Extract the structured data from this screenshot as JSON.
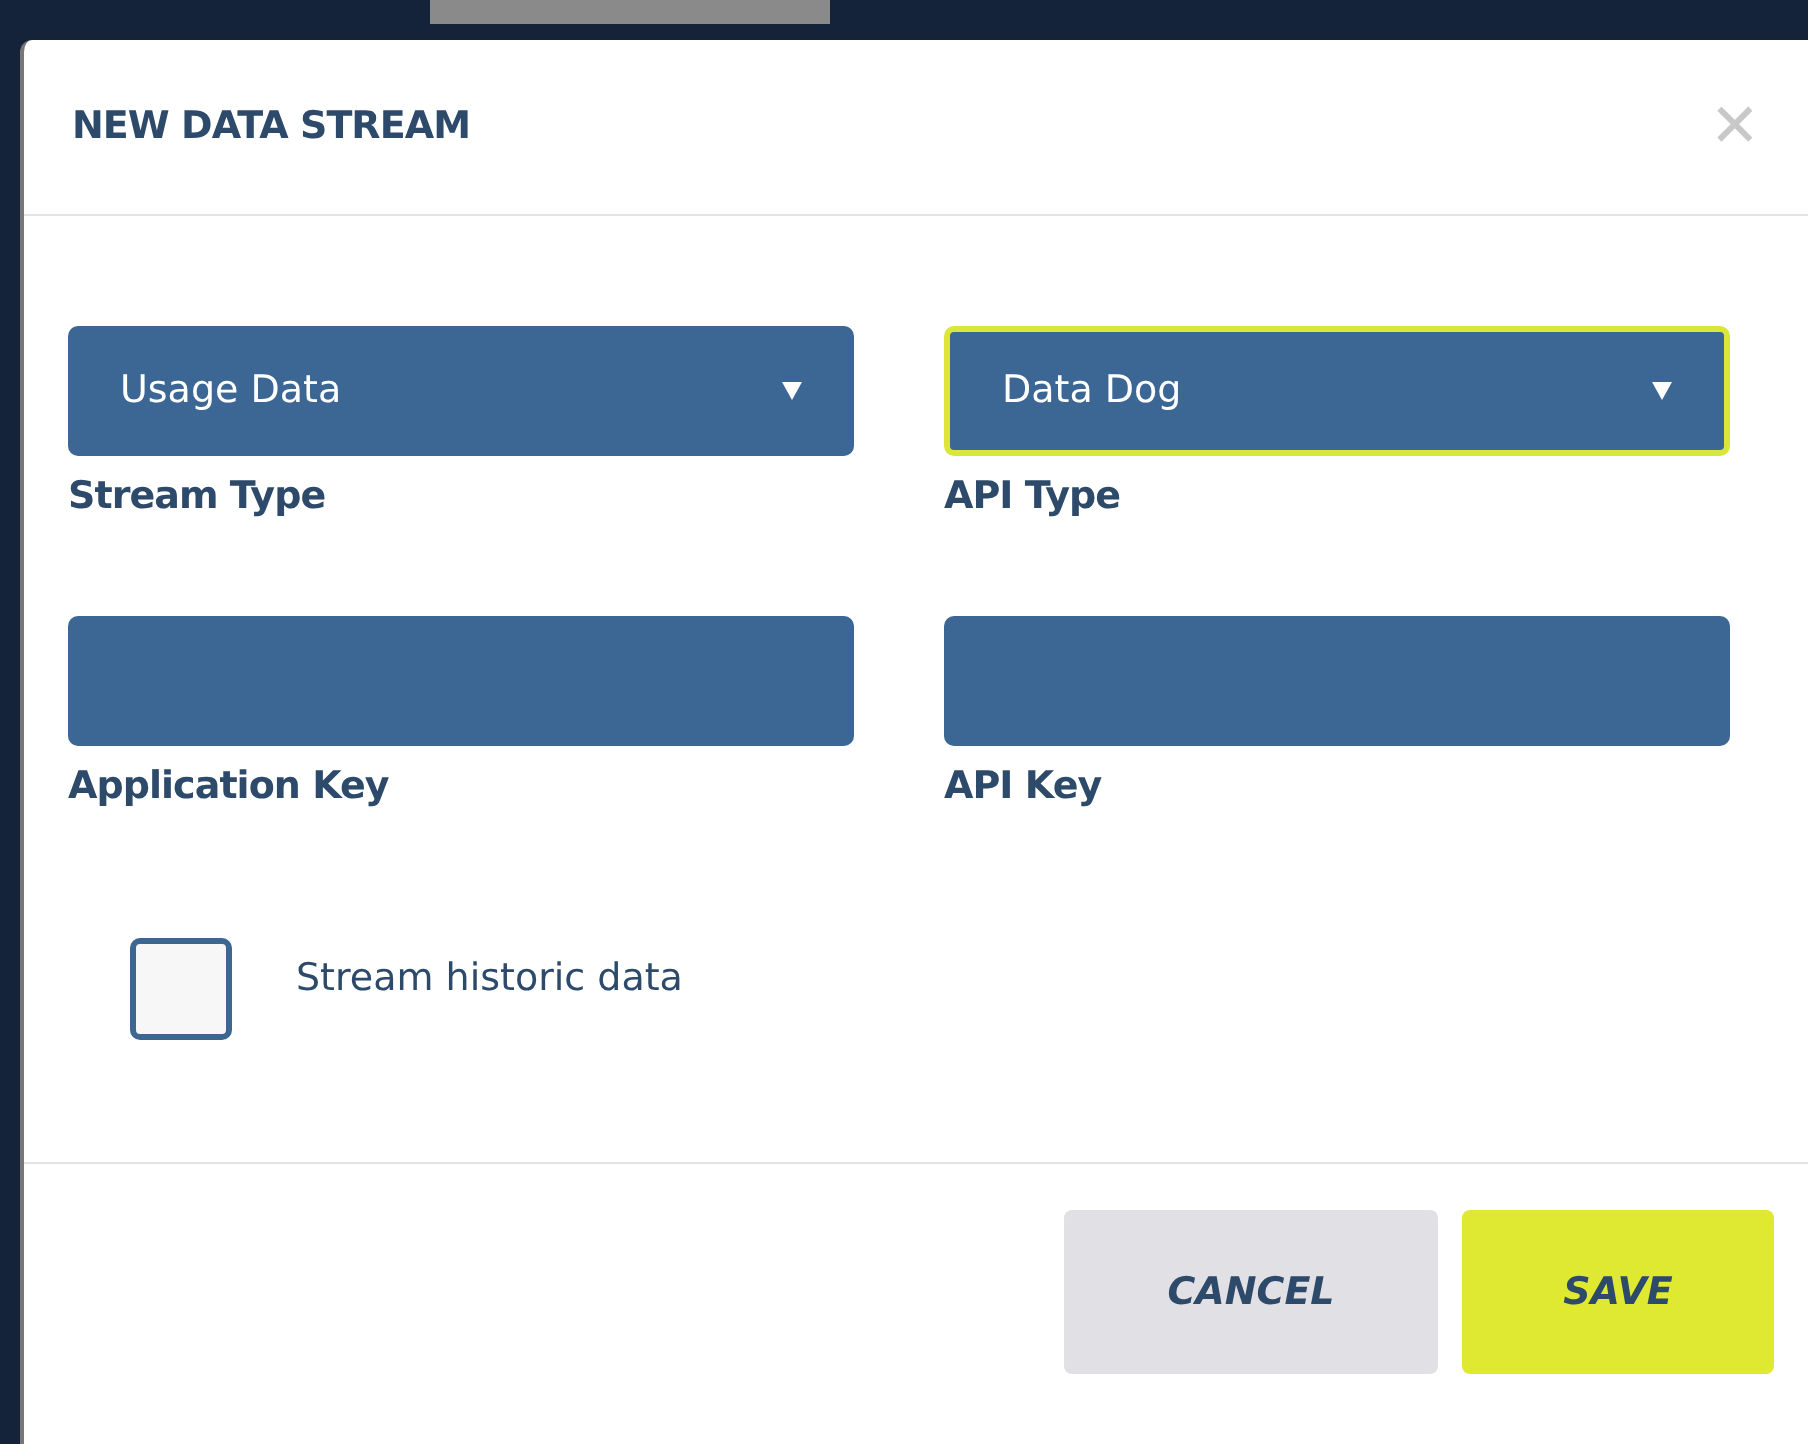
{
  "dialog": {
    "title": "NEW DATA STREAM",
    "close": "✕"
  },
  "selects": [
    {
      "value": "Usage Data",
      "label": "Stream Type",
      "focused": false
    },
    {
      "value": "Data Dog",
      "label": "API Type",
      "focused": true
    }
  ],
  "inputs": [
    {
      "label": "Application Key"
    },
    {
      "label": "API Key"
    }
  ],
  "checkbox": {
    "label": "Stream historic data",
    "checked": false
  },
  "buttons": [
    {
      "label": "CANCEL",
      "kind": "secondary"
    },
    {
      "label": "SAVE",
      "kind": "primary"
    }
  ]
}
